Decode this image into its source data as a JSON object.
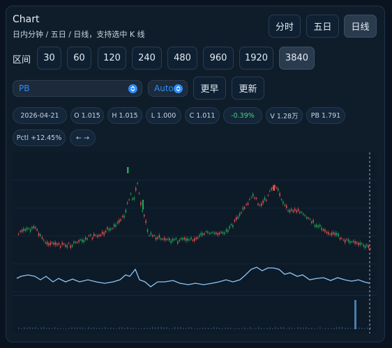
{
  "header": {
    "title": "Chart",
    "subtitle": "日内分钟 / 五日 / 日线，支持选中 K 线"
  },
  "modes": [
    {
      "label": "分时",
      "active": false
    },
    {
      "label": "五日",
      "active": false
    },
    {
      "label": "日线",
      "active": true
    }
  ],
  "range": {
    "label": "区间",
    "options": [
      {
        "label": "30",
        "active": false
      },
      {
        "label": "60",
        "active": false
      },
      {
        "label": "120",
        "active": false
      },
      {
        "label": "240",
        "active": false
      },
      {
        "label": "480",
        "active": false
      },
      {
        "label": "960",
        "active": false
      },
      {
        "label": "1920",
        "active": false
      },
      {
        "label": "3840",
        "active": true
      }
    ]
  },
  "controls": {
    "indicator_select": "PB",
    "scale_select": "Auto",
    "earlier_label": "更早",
    "refresh_label": "更新"
  },
  "info": {
    "date": "2026-04-21",
    "open": "O 1.015",
    "high": "H 1.015",
    "low": "L 1.000",
    "close": "C 1.011",
    "change": "-0.39%",
    "volume": "V 1.28万",
    "pb": "PB 1.791",
    "pctl": "Pctl +12.45%",
    "nav": "← →"
  },
  "colors": {
    "up": "#ef5350",
    "down": "#26a65b",
    "indicator_line": "#8ec8f6",
    "crosshair": "#9fb3c8",
    "accent": "#2d8dff"
  }
}
